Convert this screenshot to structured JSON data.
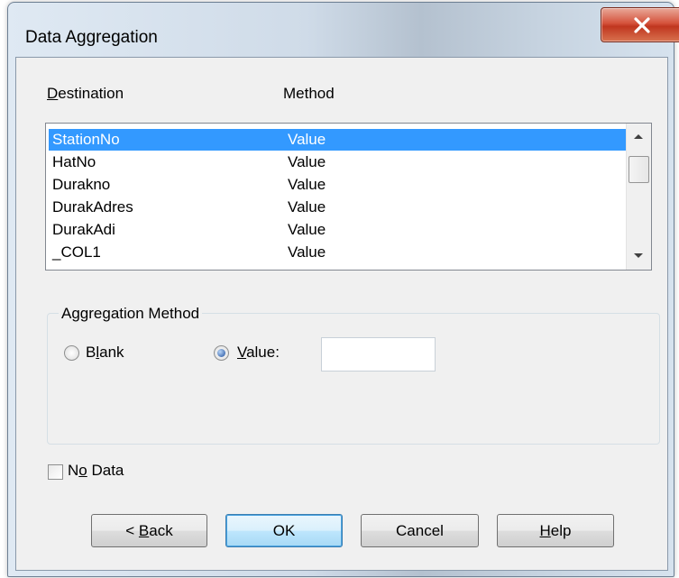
{
  "window": {
    "title": "Data Aggregation",
    "close_label": "X"
  },
  "list": {
    "col_destination": "Destination",
    "col_method": "Method",
    "rows": [
      {
        "destination": "StationNo",
        "method": "Value",
        "selected": true
      },
      {
        "destination": "HatNo",
        "method": "Value",
        "selected": false
      },
      {
        "destination": "Durakno",
        "method": "Value",
        "selected": false
      },
      {
        "destination": "DurakAdres",
        "method": "Value",
        "selected": false
      },
      {
        "destination": "DurakAdi",
        "method": "Value",
        "selected": false
      },
      {
        "destination": "_COL1",
        "method": "Value",
        "selected": false
      }
    ]
  },
  "aggregation": {
    "group_label": "Aggregation Method",
    "blank_label": "Blank",
    "value_label": "Value:",
    "selected": "value",
    "value_input": ""
  },
  "no_data": {
    "label": "No Data",
    "checked": false
  },
  "buttons": {
    "back": "< Back",
    "ok": "OK",
    "cancel": "Cancel",
    "help": "Help"
  },
  "colors": {
    "selection": "#3399ff",
    "close_button": "#c7432a"
  }
}
